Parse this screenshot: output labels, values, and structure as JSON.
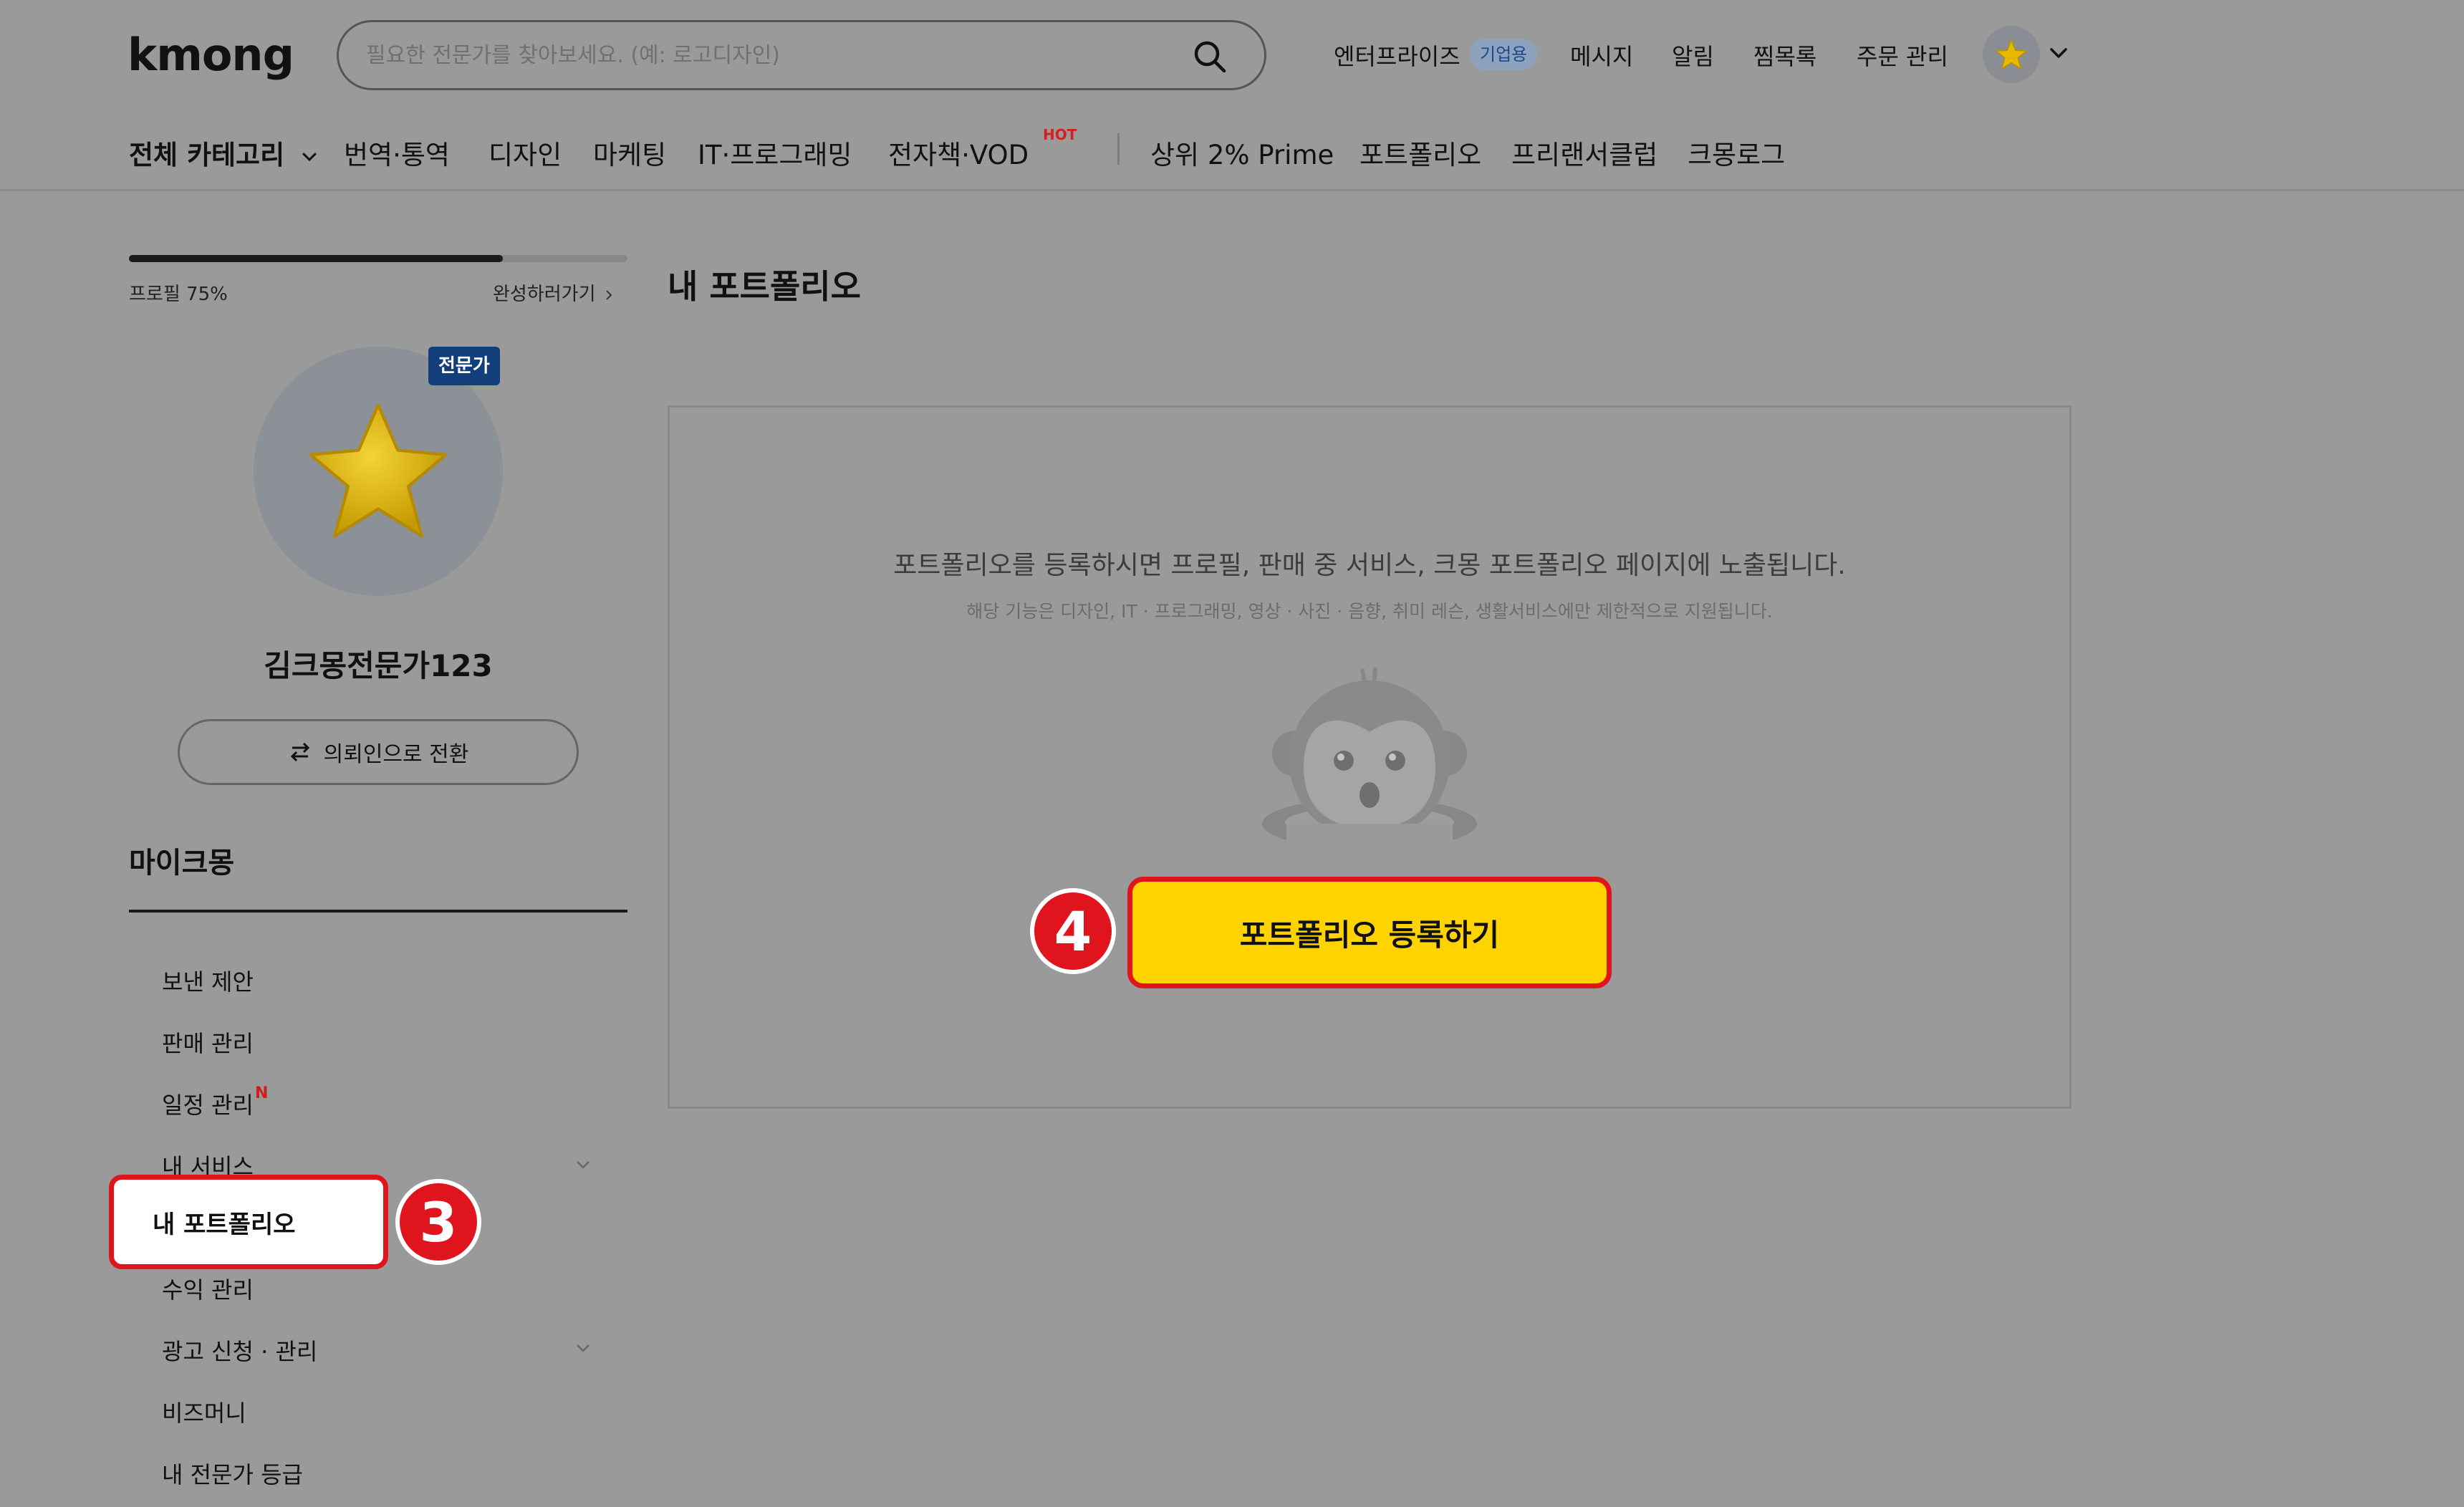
{
  "header": {
    "logo": "kmong",
    "search_placeholder": "필요한 전문가를 찾아보세요. (예: 로고디자인)",
    "links": {
      "enterprise": "엔터프라이즈",
      "enterprise_badge": "기업용",
      "messages": "메시지",
      "alerts": "알림",
      "wishlist": "찜목록",
      "orders": "주문 관리"
    }
  },
  "nav": {
    "all_categories": "전체 카테고리",
    "items": [
      "번역·통역",
      "디자인",
      "마케팅",
      "IT·프로그래밍",
      "전자책·VOD"
    ],
    "hot_label": "HOT",
    "extra": [
      "상위 2% Prime",
      "포트폴리오",
      "프리랜서클럽",
      "크몽로그"
    ]
  },
  "sidebar": {
    "profile_progress_label": "프로필 75%",
    "profile_progress": 0.75,
    "complete_link": "완성하러가기",
    "expert_badge": "전문가",
    "username": "김크몽전문가123",
    "switch_button": "의뢰인으로 전환",
    "section_title": "마이크몽",
    "menu": {
      "sent_offers": "보낸 제안",
      "sales": "판매 관리",
      "schedule": "일정 관리",
      "schedule_new": "N",
      "my_services": "내 서비스",
      "my_portfolio": "내 포트폴리오",
      "revenue": "수익 관리",
      "ads": "광고 신청 · 관리",
      "bizmoney": "비즈머니",
      "expert_grade": "내 전문가 등급"
    }
  },
  "main": {
    "title": "내 포트폴리오",
    "message": "포트폴리오를 등록하시면 프로필, 판매 중 서비스, 크몽 포트폴리오 페이지에 노출됩니다.",
    "sub_message": "해당 기능은 디자인, IT · 프로그래밍, 영상 · 사진 · 음향, 취미 레슨, 생활서비스에만 제한적으로 지원됩니다.",
    "register_button": "포트폴리오 등록하기"
  },
  "annotations": {
    "step3": "3",
    "step4": "4"
  },
  "colors": {
    "accent_yellow": "#ffd300",
    "highlight_red": "#e0141d",
    "expert_badge": "#123f7a"
  }
}
